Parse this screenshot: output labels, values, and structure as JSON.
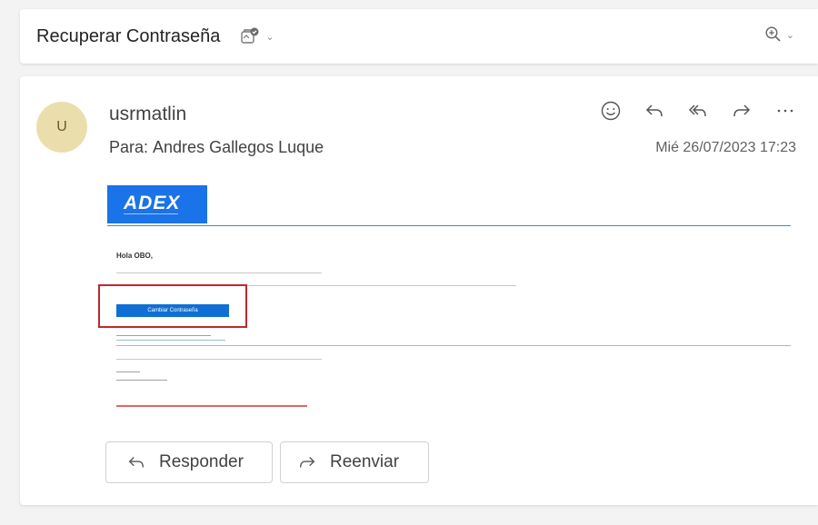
{
  "subject": {
    "title": "Recuperar Contraseña",
    "tag_icon": "tag-check-icon",
    "zoom_icon": "zoom-in-icon"
  },
  "message": {
    "avatar_initial": "U",
    "sender": "usrmatlin",
    "to_label": "Para:",
    "to_name": "Andres Gallegos Luque",
    "date": "Mié 26/07/2023 17:23",
    "actions": [
      "smiley-icon",
      "reply-icon",
      "reply-all-icon",
      "forward-icon",
      "more-icon"
    ]
  },
  "email_body": {
    "logo_text": "ADEX",
    "greeting": "Hola OBO,",
    "cta_label": "Cambiar Contraseña"
  },
  "reply_buttons": {
    "reply_label": "Responder",
    "forward_label": "Reenviar"
  },
  "colors": {
    "brand_blue": "#1a73e8",
    "highlight_red": "#c0272d",
    "avatar_bg": "#eadfac"
  }
}
